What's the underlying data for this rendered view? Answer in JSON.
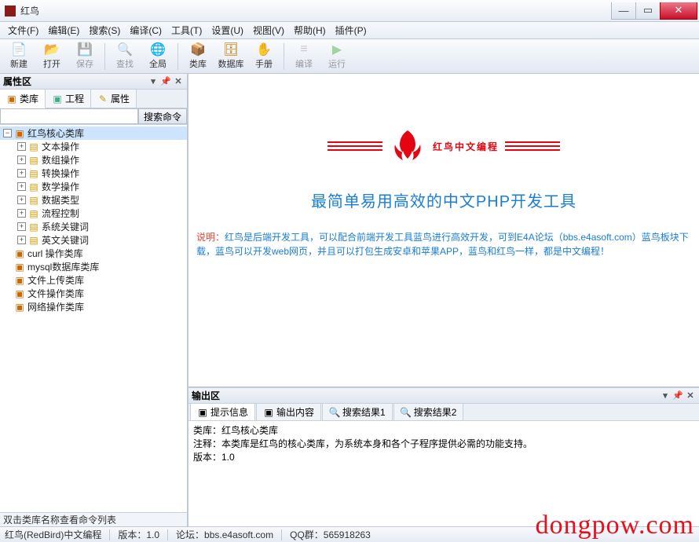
{
  "window": {
    "title": "红鸟"
  },
  "menu": {
    "file": "文件(F)",
    "edit": "编辑(E)",
    "search": "搜索(S)",
    "compile": "编译(C)",
    "tools": "工具(T)",
    "settings": "设置(U)",
    "view": "视图(V)",
    "help": "帮助(H)",
    "plugins": "插件(P)"
  },
  "toolbar": {
    "new": "新建",
    "open": "打开",
    "save": "保存",
    "find": "查找",
    "global": "全局",
    "lib": "类库",
    "db": "数据库",
    "manual": "手册",
    "compile": "编译",
    "run": "运行"
  },
  "left": {
    "title": "属性区",
    "tabs": {
      "lib": "类库",
      "project": "工程",
      "props": "属性"
    },
    "search_btn": "搜索命令",
    "footer": "双击类库名称查看命令列表",
    "tree": {
      "root": "红鸟核心类库",
      "children": [
        "文本操作",
        "数组操作",
        "转换操作",
        "数学操作",
        "数据类型",
        "流程控制",
        "系统关键词",
        "英文关键词"
      ],
      "siblings": [
        "curl 操作类库",
        "mysql数据库类库",
        "文件上传类库",
        "文件操作类库",
        "网络操作类库"
      ]
    }
  },
  "content": {
    "title": "红鸟中文编程",
    "subtitle": "最简单易用高效的中文PHP开发工具",
    "desc_label": "说明：",
    "desc": "红鸟是后端开发工具，可以配合前端开发工具蓝鸟进行高效开发，可到E4A论坛（bbs.e4asoft.com）蓝鸟板块下载，蓝鸟可以开发web网页，并且可以打包生成安卓和苹果APP，蓝鸟和红鸟一样，都是中文编程！"
  },
  "output": {
    "title": "输出区",
    "tabs": {
      "hint": "提示信息",
      "content": "输出内容",
      "res1": "搜索结果1",
      "res2": "搜索结果2"
    },
    "body_line1": "类库：红鸟核心类库",
    "body_line2": "注释：本类库是红鸟的核心类库，为系统本身和各个子程序提供必需的功能支持。",
    "body_line3": "版本：1.0"
  },
  "status": {
    "app": "红鸟(RedBird)中文编程",
    "version": "版本：1.0",
    "forum": "论坛：bbs.e4asoft.com",
    "qq": "QQ群：565918263"
  },
  "watermark": "dongpow.com"
}
